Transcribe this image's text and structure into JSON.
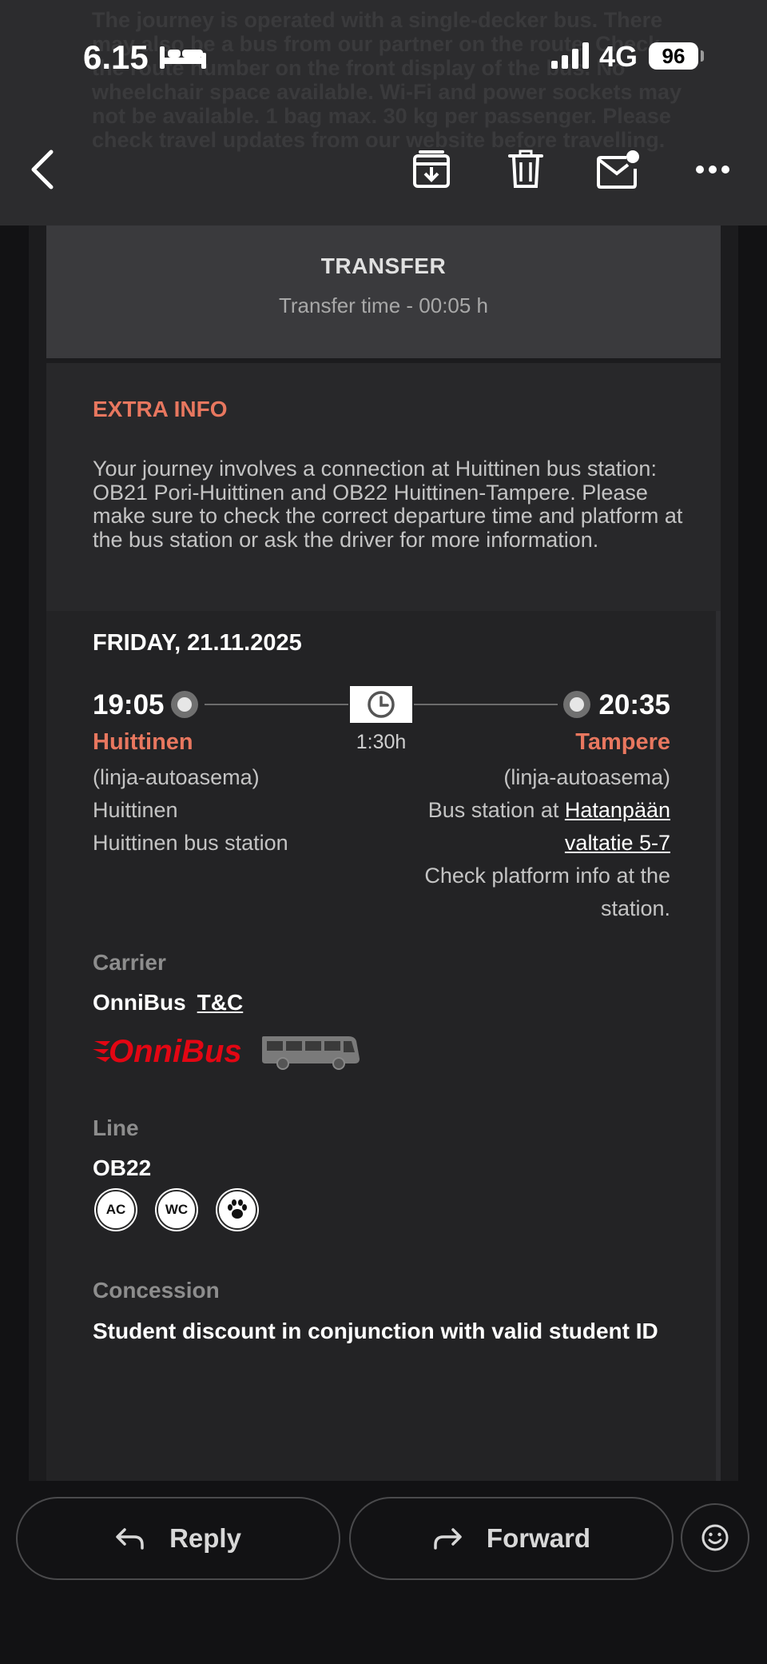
{
  "status_bar": {
    "time": "6.15",
    "network": "4G",
    "battery": "96"
  },
  "background_overlay_text": "The journey is operated with a single-decker bus. There may also be a bus from our partner on the route. Check the route number on the front display of the bus. No wheelchair space available. Wi-Fi and power sockets may not be available. 1 bag max. 30 kg per passenger. Please check travel updates from our website before travelling.",
  "toolbar": {
    "icons": [
      "back-icon",
      "archive-icon",
      "trash-icon",
      "unread-mail-icon",
      "more-icon"
    ]
  },
  "transfer": {
    "title": "TRANSFER",
    "time_text": "Transfer time - 00:05 h"
  },
  "extra_info": {
    "title": "EXTRA INFO",
    "body": "Your journey involves a connection at Huittinen bus station: OB21 Pori-Huittinen and OB22 Huittinen-Tampere. Please make sure to check the correct departure time and platform at the bus station or ask the driver for more information."
  },
  "trip": {
    "date": "FRIDAY, 21.11.2025",
    "departure": {
      "time": "19:05",
      "city": "Huittinen",
      "lines": [
        "(linja-autoasema)",
        "Huittinen",
        "Huittinen bus station"
      ]
    },
    "duration": "1:30h",
    "arrival": {
      "time": "20:35",
      "city": "Tampere",
      "line1": "(linja-autoasema)",
      "line2_prefix": "Bus station at ",
      "address_part1": "Hatanpään",
      "address_part2": "valtatie 5-7",
      "note_line1": "Check platform info at the",
      "note_line2": "station."
    },
    "carrier": {
      "label": "Carrier",
      "name": "OnniBus",
      "tc_link": "T&C",
      "logo_text": "OnniBus"
    },
    "line": {
      "label": "Line",
      "value": "OB22",
      "amenities": [
        "AC",
        "WC",
        "paw-icon"
      ]
    },
    "concession": {
      "label": "Concession",
      "value": "Student discount in conjunction with valid student ID"
    }
  },
  "actions": {
    "reply": "Reply",
    "forward": "Forward"
  },
  "colors": {
    "accent_red": "#e8775f",
    "brand_red": "#e30613"
  }
}
